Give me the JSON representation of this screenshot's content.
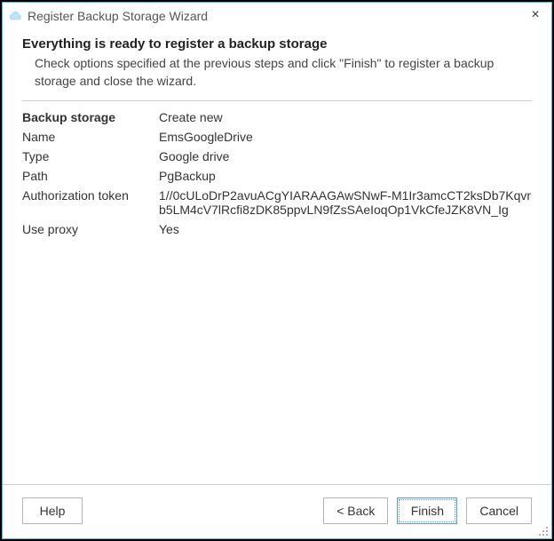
{
  "window": {
    "title": "Register Backup Storage Wizard"
  },
  "page": {
    "heading": "Everything is ready to register a backup storage",
    "subheading": "Check options specified at the previous steps and click \"Finish\" to register a backup storage and close the wizard."
  },
  "summary": {
    "backup_storage": {
      "label": "Backup storage",
      "value": "Create new"
    },
    "name": {
      "label": "Name",
      "value": "EmsGoogleDrive"
    },
    "type": {
      "label": "Type",
      "value": "Google drive"
    },
    "path": {
      "label": "Path",
      "value": "PgBackup"
    },
    "auth_token": {
      "label": "Authorization token",
      "value": "1//0cULoDrP2avuACgYIARAAGAwSNwF-M1Ir3amcCT2ksDb7Kqvrb5LM4cV7lRcfi8zDK85ppvLN9fZsSAeIoqOp1VkCfeJZK8VN_Ig"
    },
    "use_proxy": {
      "label": "Use proxy",
      "value": "Yes"
    }
  },
  "buttons": {
    "help": "Help",
    "back": "< Back",
    "finish": "Finish",
    "cancel": "Cancel"
  }
}
